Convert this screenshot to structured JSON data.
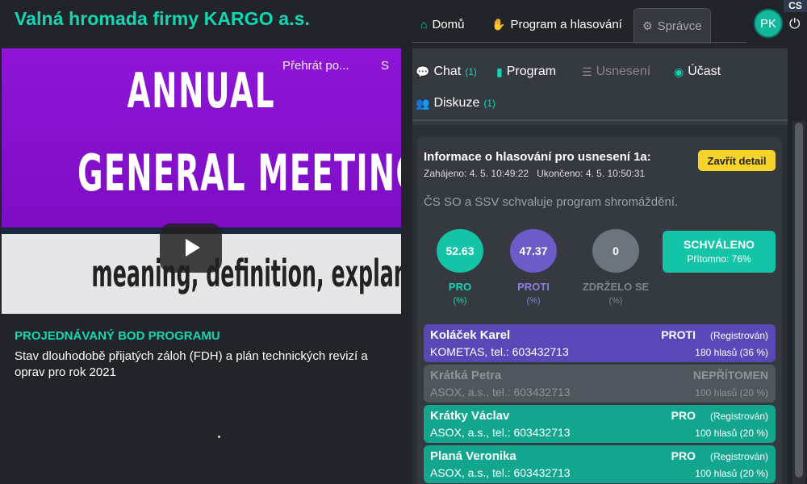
{
  "app": {
    "title": "Valná hromada firmy KARGO a.s."
  },
  "video": {
    "overlay_title": "Přehrát po...",
    "overlay_s": "S",
    "line1": "ANNUAL",
    "line2": "GENERAL MEETING",
    "line3": "meaning, definition, explanation..."
  },
  "agenda": {
    "label": "PROJEDNÁVANÝ BOD PROGRAMU",
    "text": "Stav dlouhodobě přijatých záloh (FDH) a plán technických revizí a oprav pro rok 2021"
  },
  "topnav": {
    "home": "Domů",
    "program_vote": "Program a hlasování",
    "admin": "Správce",
    "avatar": "PK",
    "lang": "CS"
  },
  "subtabs": {
    "chat": "Chat",
    "chat_count": "(1)",
    "program": "Program",
    "resolutions": "Usnesení",
    "attendance": "Účast",
    "discussion": "Diskuze",
    "discussion_count": "(1)"
  },
  "vote": {
    "title": "Informace o hlasování pro usnesení 1a:",
    "started_label": "Zahájeno: 4. 5. 10:49:22",
    "ended_label": "Ukončeno: 4. 5. 10:50:31",
    "close_label": "Zavřít detail",
    "description": "ČS SO a SSV schvaluje program shromáždění.",
    "pro": {
      "value": "52.63",
      "label": "PRO",
      "unit": "(%)"
    },
    "proti": {
      "value": "47.37",
      "label": "PROTI",
      "unit": "(%)"
    },
    "abstain": {
      "value": "0",
      "label": "ZDRŽELO SE",
      "unit": "(%)"
    },
    "result": {
      "label": "SCHVÁLENO",
      "present": "Přítomno: 76%"
    }
  },
  "voters": [
    {
      "name": "Koláček Karel",
      "org": "KOMETAS, tel.: 603432713",
      "status": "PROTI",
      "reg": "(Registrován)",
      "votes": "180 hlasů (36 %)"
    },
    {
      "name": "Krátká Petra",
      "org": "ASOX, a.s., tel.: 603432713",
      "status": "NEPŘÍTOMEN",
      "reg": "",
      "votes": "100 hlasů (20 %)"
    },
    {
      "name": "Krátky Václav",
      "org": "ASOX, a.s., tel.: 603432713",
      "status": "PRO",
      "reg": "(Registrován)",
      "votes": "100 hlasů (20 %)"
    },
    {
      "name": "Planá Veronika",
      "org": "ASOX, a.s., tel.: 603432713",
      "status": "PRO",
      "reg": "(Registrován)",
      "votes": "100 hlasů (20 %)"
    }
  ],
  "colors": {
    "accent": "#13d6b4",
    "pro": "#13c4a6",
    "proti": "#6b5cc7",
    "abstain": "#6c757d",
    "warning": "#f5d328"
  }
}
